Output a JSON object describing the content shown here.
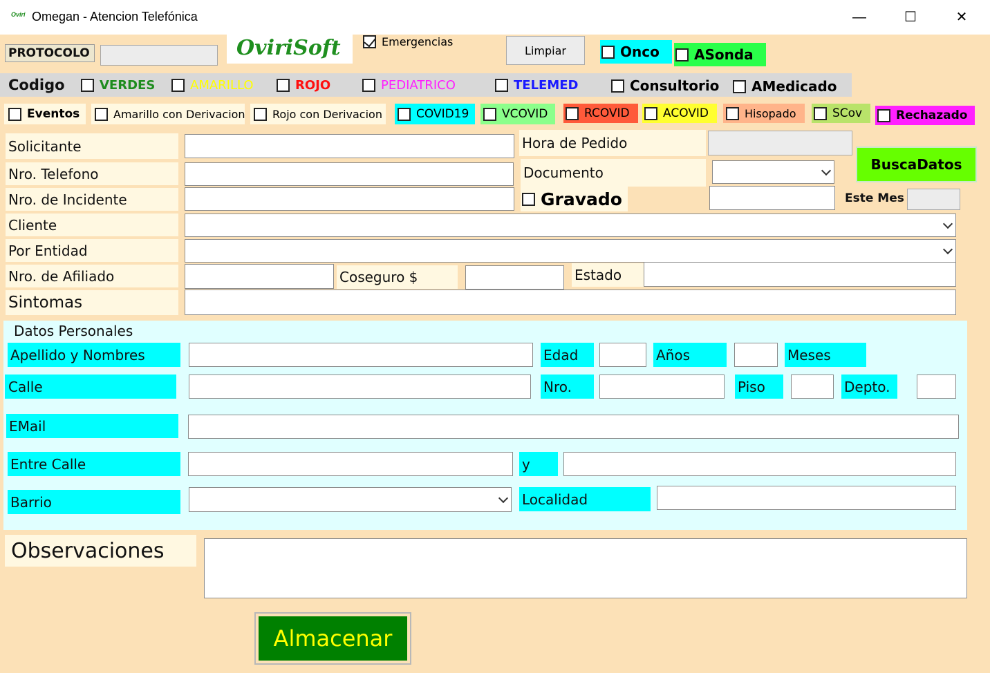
{
  "window": {
    "app_icon_text": "Oviri",
    "title": "Omegan - Atencion Telefónica",
    "minimize": "—",
    "maximize": "☐",
    "close": "✕"
  },
  "header": {
    "protocolo_label": "PROTOCOLO",
    "logo": "OviriSoft",
    "emergencias": "Emergencias",
    "limpiar": "Limpiar",
    "onco": "Onco",
    "asonda": "ASonda"
  },
  "codigo_row": {
    "label": "Codigo",
    "verdes": "VERDES",
    "amarillo": "AMARILLO",
    "rojo": "ROJO",
    "pediatrico": "PEDIATRICO",
    "telemed": "TELEMED",
    "consultorio": "Consultorio",
    "amedicado": "AMedicado"
  },
  "eventos_row": {
    "eventos": "Eventos",
    "amarillo_deriv": "Amarillo con Derivacion",
    "rojo_deriv": "Rojo con Derivacion",
    "covid19": "COVID19",
    "vcovid": "VCOVID",
    "rcovid": "RCOVID",
    "acovid": "ACOVID",
    "hisopado": "Hisopado",
    "scov": "SCov",
    "rechazado": "Rechazado"
  },
  "form": {
    "solicitante": "Solicitante",
    "nro_telefono": "Nro. Telefono",
    "nro_incidente": "Nro. de Incidente",
    "cliente": "Cliente",
    "por_entidad": "Por Entidad",
    "nro_afiliado": "Nro. de Afiliado",
    "coseguro": "Coseguro $",
    "estado": "Estado",
    "sintomas": "Sintomas",
    "hora_pedido": "Hora de Pedido",
    "documento": "Documento",
    "gravado": "Gravado",
    "buscadatos": "BuscaDatos",
    "este_mes": "Este Mes"
  },
  "personal": {
    "group": "Datos Personales",
    "apellido": "Apellido y Nombres",
    "edad": "Edad",
    "anios": "Años",
    "meses": "Meses",
    "calle": "Calle",
    "nro": "Nro.",
    "piso": "Piso",
    "depto": "Depto.",
    "email": "EMail",
    "entre_calle": "Entre Calle",
    "y": "y",
    "barrio": "Barrio",
    "localidad": "Localidad"
  },
  "footer": {
    "observaciones": "Observaciones",
    "almacenar": "Almacenar"
  },
  "colors": {
    "background": "#fce1b7",
    "cyan": "#00ffff",
    "green_button": "#008000",
    "busca_button": "#66ff00"
  }
}
